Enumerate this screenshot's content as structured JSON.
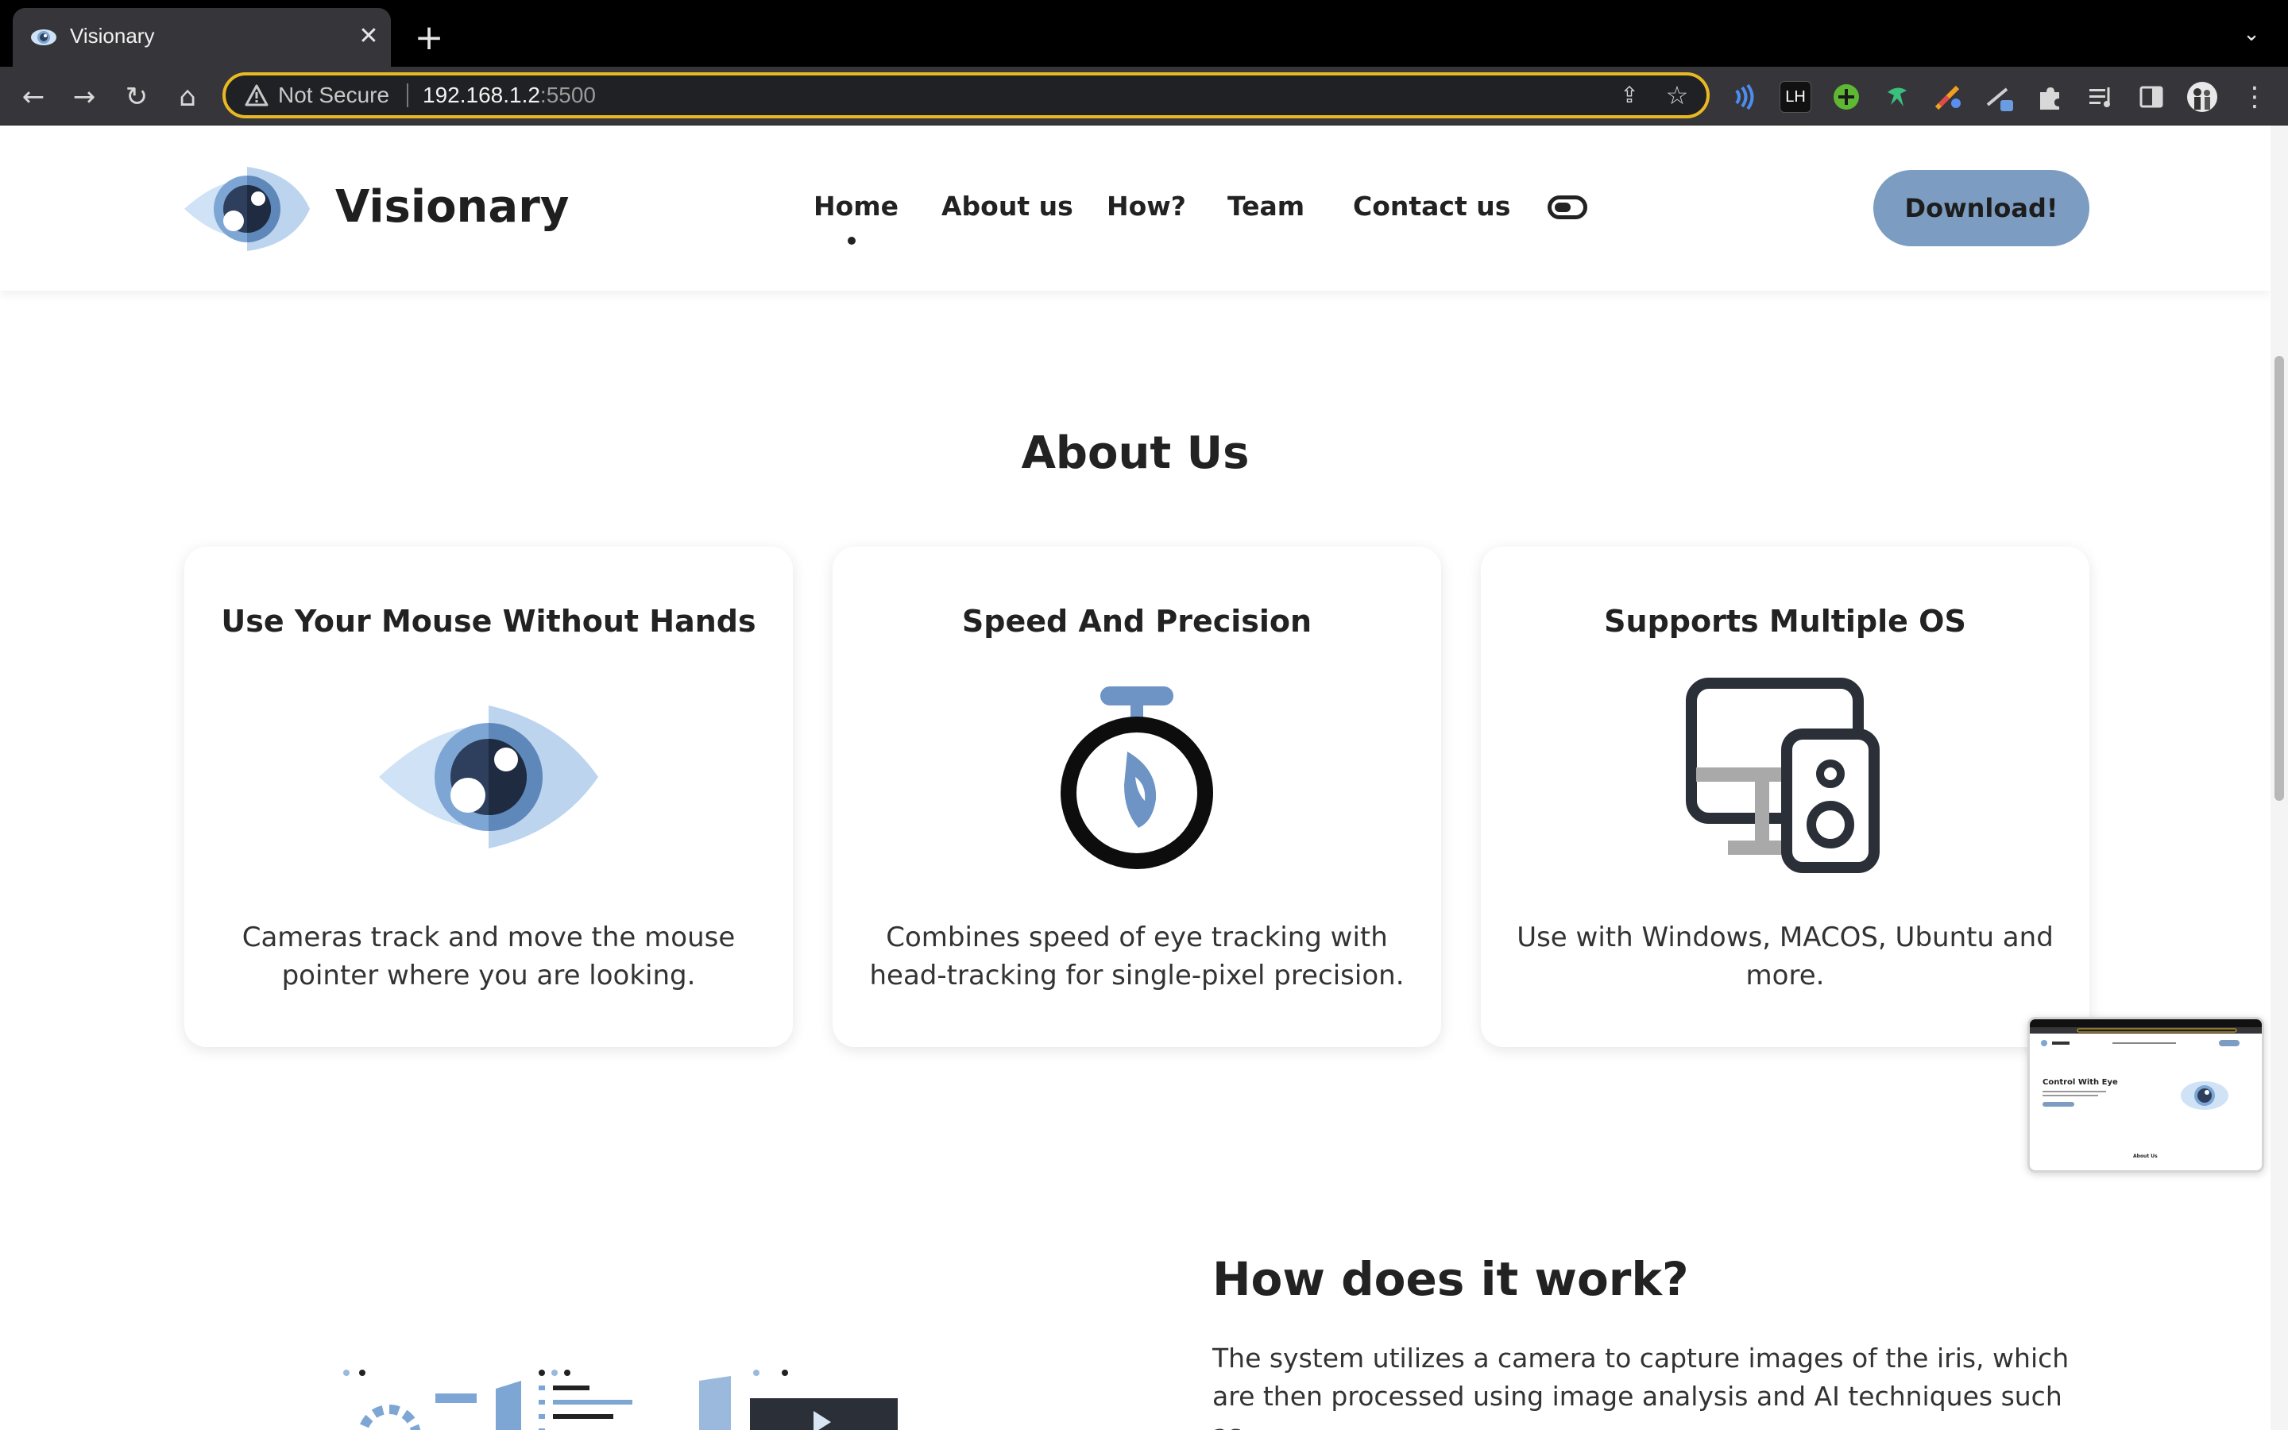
{
  "browser": {
    "tab_title": "Visionary",
    "close_glyph": "✕",
    "new_tab_glyph": "+",
    "tab_menu_glyph": "⌄",
    "security_label": "Not Secure",
    "url_host": "192.168.1.2",
    "url_port": ":5500",
    "nav_back_glyph": "←",
    "nav_forward_glyph": "→",
    "reload_glyph": "↻",
    "home_glyph": "⌂",
    "share_glyph": "⇪",
    "star_glyph": "☆",
    "menu_glyph": "⋮",
    "extension_icons": [
      "audio-ext-icon",
      "lh-ext-icon",
      "plus-ext-icon",
      "bird-ext-icon",
      "palette-ext-icon",
      "pen-ext-icon",
      "puzzle-icon",
      "reading-list-icon",
      "side-panel-icon",
      "profile-avatar"
    ],
    "lh_label": "LH"
  },
  "site": {
    "brand": "Visionary",
    "nav": [
      "Home",
      "About us",
      "How?",
      "Team",
      "Contact us"
    ],
    "active_nav": "Home",
    "download_label": "Download!",
    "colors": {
      "accent": "#7c9dc1",
      "eye_light": "#cfe2f6",
      "eye_mid": "#7ea6d4",
      "eye_dark": "#2d3f5c",
      "text": "#222222"
    }
  },
  "about": {
    "title": "About Us",
    "cards": [
      {
        "title": "Use Your Mouse Without Hands",
        "icon": "eye-icon",
        "text": "Cameras track and move the mouse pointer where you are looking."
      },
      {
        "title": "Speed And Precision",
        "icon": "stopwatch-icon",
        "text": "Combines speed of eye tracking with head-tracking for single-pixel precision."
      },
      {
        "title": "Supports Multiple OS",
        "icon": "devices-icon",
        "text": "Use with Windows, MACOS, Ubuntu and more."
      }
    ]
  },
  "how": {
    "title": "How does it work?",
    "text": "The system utilizes a camera to capture images of the iris, which are then processed using image analysis and AI techniques such as"
  },
  "pip_preview": {
    "heading": "Control With Eye",
    "footer": "About Us"
  }
}
